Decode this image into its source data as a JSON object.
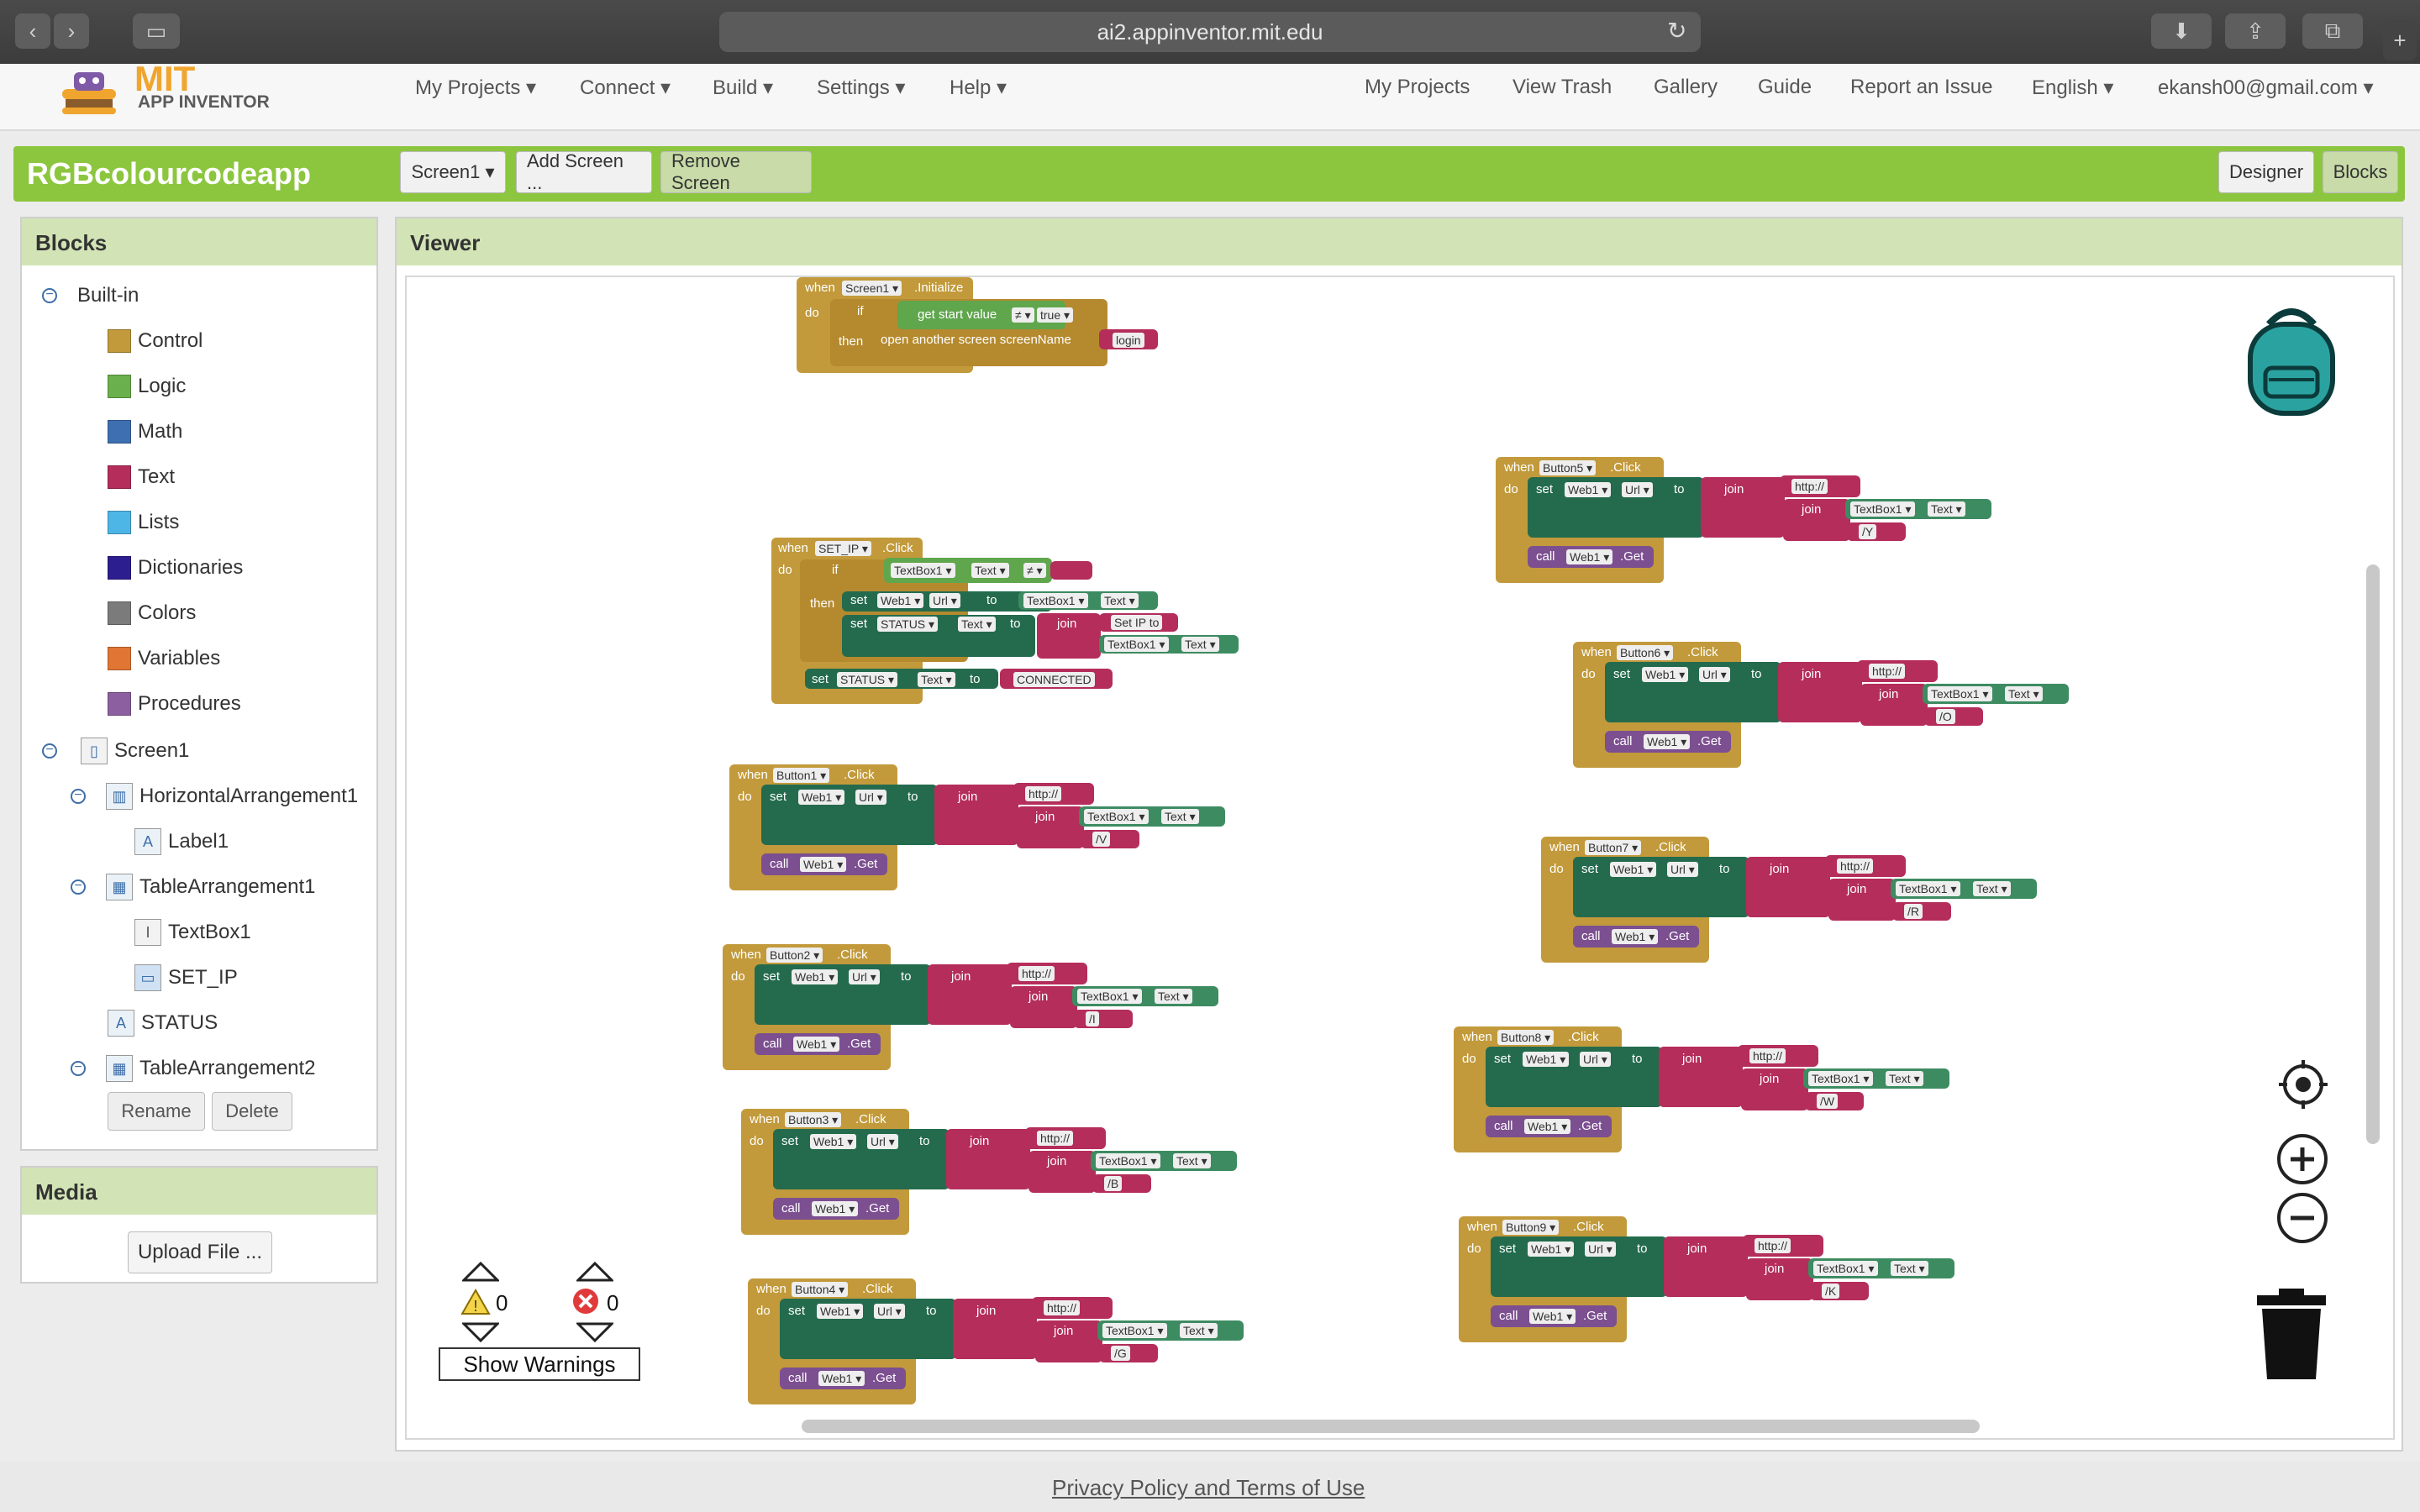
{
  "browser": {
    "url": "ai2.appinventor.mit.edu",
    "back_icon": "chevron-left-icon",
    "forward_icon": "chevron-right-icon",
    "sidebar_icon": "sidebar-icon",
    "reload_icon": "reload-icon",
    "download_icon": "download-icon",
    "share_icon": "share-icon",
    "tabs_icon": "tabs-icon",
    "new_tab_icon": "plus-icon"
  },
  "header": {
    "logo_mit": "MIT",
    "logo_app": "APP INVENTOR",
    "nav_left": [
      "My Projects ▾",
      "Connect ▾",
      "Build ▾",
      "Settings ▾",
      "Help ▾"
    ],
    "nav_right": [
      "My Projects",
      "View Trash",
      "Gallery",
      "Guide",
      "Report an Issue",
      "English ▾",
      "ekansh00@gmail.com ▾"
    ]
  },
  "toolbar": {
    "project_name": "RGBcolourcodeapp",
    "screen_select": "Screen1 ▾",
    "add_screen": "Add Screen ...",
    "remove_screen": "Remove Screen",
    "designer": "Designer",
    "blocks": "Blocks"
  },
  "blocks_panel": {
    "title": "Blocks",
    "builtin": "Built-in",
    "categories": [
      {
        "label": "Control",
        "color": "#c29a3b"
      },
      {
        "label": "Logic",
        "color": "#6ab04c"
      },
      {
        "label": "Math",
        "color": "#3e6fb0"
      },
      {
        "label": "Text",
        "color": "#b42d5b"
      },
      {
        "label": "Lists",
        "color": "#4db6e6"
      },
      {
        "label": "Dictionaries",
        "color": "#2d1e8f"
      },
      {
        "label": "Colors",
        "color": "#7b7b7b"
      },
      {
        "label": "Variables",
        "color": "#e07534"
      },
      {
        "label": "Procedures",
        "color": "#8c5fa0"
      }
    ],
    "components": {
      "screen": "Screen1",
      "horizontal": "HorizontalArrangement1",
      "label1": "Label1",
      "table1": "TableArrangement1",
      "textbox": "TextBox1",
      "set_ip": "SET_IP",
      "status": "STATUS",
      "table2": "TableArrangement2"
    },
    "rename": "Rename",
    "delete": "Delete"
  },
  "media": {
    "title": "Media",
    "upload": "Upload File ..."
  },
  "viewer": {
    "title": "Viewer",
    "warnings_count": "0",
    "errors_count": "0",
    "show_warnings": "Show Warnings"
  },
  "blocks": {
    "init": {
      "when": "when",
      "comp": "Screen1 ▾",
      "event": ".Initialize",
      "do": "do",
      "if": "if",
      "then": "then",
      "get_start": "get start value",
      "neq": "≠ ▾",
      "true": "true ▾",
      "open_screen": "open another screen  screenName",
      "login": "login"
    },
    "setip": {
      "when": "when",
      "comp": "SET_IP ▾",
      "event": ".Click",
      "do": "do",
      "if": "if",
      "then": "then",
      "tb": "TextBox1 ▾",
      "text": "Text ▾",
      "neq": "≠ ▾",
      "empty": "",
      "set": "set",
      "web": "Web1 ▾",
      "url": "Url ▾",
      "to": "to",
      "status": "STATUS ▾",
      "join": "join",
      "set_ip_to": "Set IP to",
      "connected": "CONNECTED"
    },
    "buttons": [
      {
        "name": "Button1 ▾",
        "suffix": "/V"
      },
      {
        "name": "Button2 ▾",
        "suffix": "/I"
      },
      {
        "name": "Button3 ▾",
        "suffix": "/B"
      },
      {
        "name": "Button4 ▾",
        "suffix": "/G"
      },
      {
        "name": "Button5 ▾",
        "suffix": "/Y"
      },
      {
        "name": "Button6 ▾",
        "suffix": "/O"
      },
      {
        "name": "Button7 ▾",
        "suffix": "/R"
      },
      {
        "name": "Button8 ▾",
        "suffix": "/W"
      },
      {
        "name": "Button9 ▾",
        "suffix": "/K"
      }
    ],
    "common": {
      "when": "when",
      "click": ".Click",
      "do": "do",
      "set": "set",
      "web": "Web1 ▾",
      "url": "Url ▾",
      "to": "to",
      "join": "join",
      "http": "http://",
      "tb": "TextBox1 ▾",
      "text": "Text ▾",
      "call": "call",
      "get": ".Get"
    }
  },
  "footer": {
    "link": "Privacy Policy and Terms of Use"
  }
}
